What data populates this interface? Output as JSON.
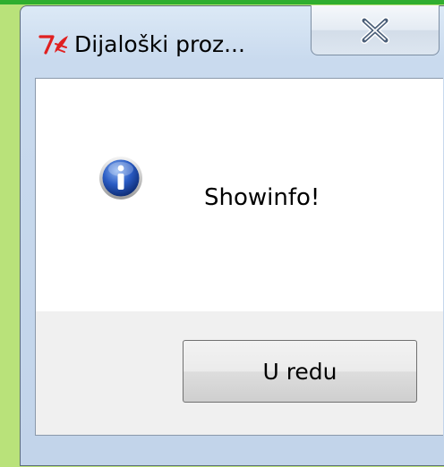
{
  "window": {
    "title": "Dijaloški proz...",
    "app_icon": "tk-feather-icon",
    "close_icon": "close-x-icon"
  },
  "message": {
    "icon": "info-icon",
    "text": "Showinfo!"
  },
  "buttons": {
    "ok_label": "U redu"
  },
  "colors": {
    "desktop_background": "#b9e27a",
    "top_strip": "#2fae2f",
    "window_frame": "#c9daee",
    "client_white": "#ffffff",
    "button_area": "#f0f0f0",
    "app_icon_red": "#e02020",
    "info_icon_blue": "#1f4fb0"
  }
}
